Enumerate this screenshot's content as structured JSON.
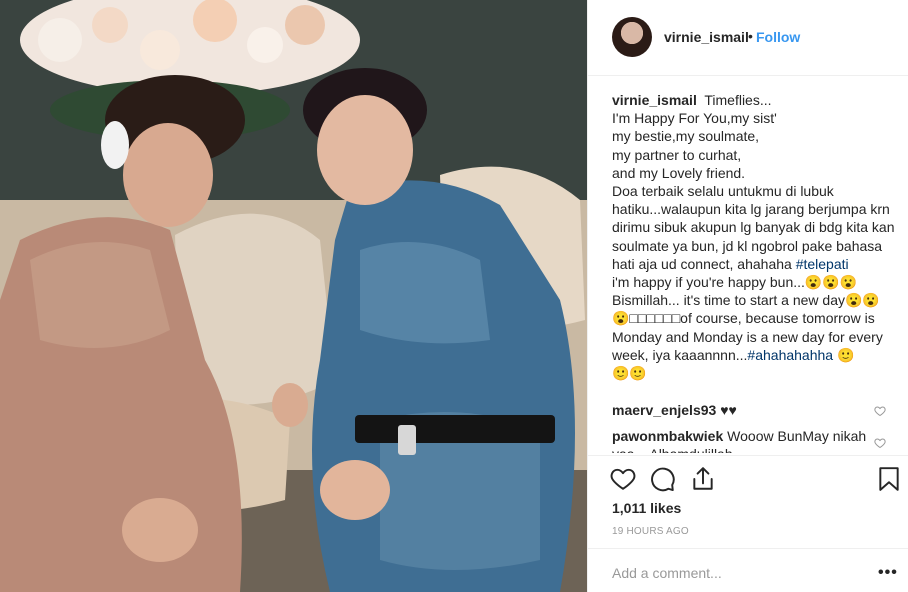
{
  "post": {
    "username": "virnie_ismail",
    "follow_label": "Follow",
    "separator": "•"
  },
  "caption": {
    "username": "virnie_ismail",
    "text_main": "Timeflies...\nI'm Happy For You,my sist'\nmy bestie,my soulmate,\nmy partner to curhat,\nand my Lovely friend.\nDoa terbaik selalu untukmu di lubuk hatiku...walaupun kita lg jarang berjumpa krn dirimu sibuk akupun lg banyak di bdg kita kan soulmate ya bun, jd kl ngobrol pake bahasa hati aja ud connect, ahahaha ",
    "hashtag1": "#telepati",
    "text_after": "\ni'm happy if you're happy bun...😮😮😮\nBismillah... it's time to start a new day😮😮\n😮□□□□□□of course, because tomorrow is Monday and Monday is a new day for every week, iya kaaannnn...",
    "hashtag2": "#ahahahahha",
    "text_end": " 🙂\n🙂🙂"
  },
  "comments": [
    {
      "username": "maerv_enjels93",
      "text": "♥♥"
    },
    {
      "username": "pawonmbakwiek",
      "text": "Wooow BunMay nikah yaa... Alhamdulillah"
    }
  ],
  "icons": {
    "like": "heart-outline-icon",
    "comment": "speech-bubble-icon",
    "share": "share-upload-icon",
    "save": "bookmark-icon",
    "comment_like": "small-heart-icon",
    "more": "ellipsis-icon"
  },
  "likes_text": "1,011 likes",
  "timestamp": "19 HOURS AGO",
  "add_comment_placeholder": "Add a comment...",
  "more_label": "•••",
  "colors": {
    "follow": "#3897f0",
    "hashtag": "#003569",
    "muted": "#999999",
    "border": "#efefef"
  }
}
